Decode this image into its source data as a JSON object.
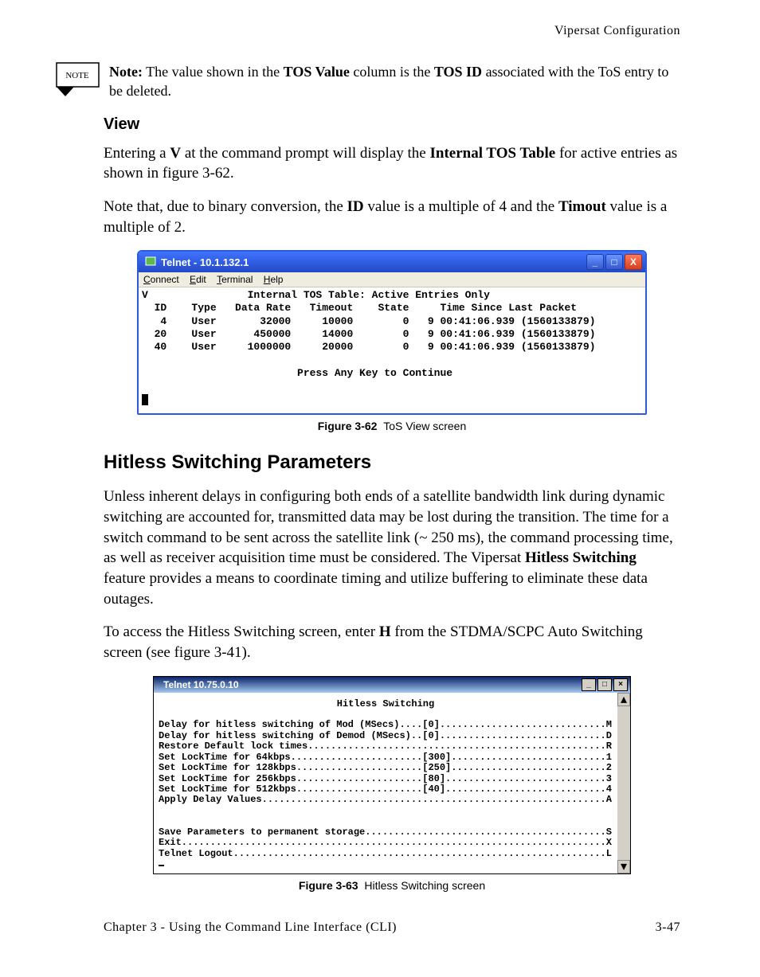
{
  "runningHead": "Vipersat Configuration",
  "note": {
    "label": "Note:",
    "text_before": "The value shown in the ",
    "tos_value": "TOS Value",
    "text_mid": " column is the ",
    "tos_id": "TOS ID",
    "text_after": " associated with the ToS entry to be deleted.",
    "iconLabel": "NOTE"
  },
  "view": {
    "heading": "View",
    "p1_a": "Entering a ",
    "p1_V": "V",
    "p1_b": " at the command prompt will display the ",
    "p1_ITT": "Internal TOS Table",
    "p1_c": " for active entries as shown in figure 3-62.",
    "p2_a": "Note that, due to binary conversion, the ",
    "p2_ID": "ID",
    "p2_b": " value is a multiple of 4 and the ",
    "p2_T": "Timout",
    "p2_c": " value is a multiple of 2."
  },
  "win1": {
    "title": "Telnet - 10.1.132.1",
    "menu": {
      "connect": "Connect",
      "edit": "Edit",
      "terminal": "Terminal",
      "help": "Help"
    },
    "terminalLines": [
      "V                Internal TOS Table: Active Entries Only",
      "  ID    Type   Data Rate   Timeout    State     Time Since Last Packet",
      "   4    User       32000     10000        0   9 00:41:06.939 (1560133879)",
      "  20    User      450000     14000        0   9 00:41:06.939 (1560133879)",
      "  40    User     1000000     20000        0   9 00:41:06.939 (1560133879)",
      "",
      "                         Press Any Key to Continue",
      ""
    ],
    "caption_b": "Figure 3-62",
    "caption_r": "ToS View screen"
  },
  "hitless": {
    "heading": "Hitless Switching Parameters",
    "p1_a": "Unless inherent delays in configuring both ends of a satellite bandwidth link during dynamic switching are accounted for, transmitted data may be lost during the transition. The time for a switch command to be sent across the satellite link (~ 250 ms), the command processing time, as well as receiver acquisition time must be considered. The Vipersat ",
    "p1_HS": "Hitless Switching",
    "p1_b": " feature provides a means to coordinate timing and utilize buffering to eliminate these data outages.",
    "p2_a": "To access the Hitless Switching screen, enter ",
    "p2_H": "H",
    "p2_b": " from the STDMA/SCPC Auto Switching screen (see figure 3-41)."
  },
  "win2": {
    "title": "Telnet 10.75.0.10",
    "heading": "Hitless Switching",
    "lines": [
      "Delay for hitless switching of Mod (MSecs)....[0].............................M",
      "Delay for hitless switching of Demod (MSecs)..[0].............................D",
      "Restore Default lock times....................................................R",
      "Set LockTime for 64kbps.......................[300]...........................1",
      "Set LockTime for 128kbps......................[250]...........................2",
      "Set LockTime for 256kbps......................[80]............................3",
      "Set LockTime for 512kbps......................[40]............................4",
      "Apply Delay Values............................................................A",
      "",
      "",
      "Save Parameters to permanent storage..........................................S",
      "Exit..........................................................................X",
      "Telnet Logout.................................................................L"
    ],
    "caption_b": "Figure 3-63",
    "caption_r": "Hitless Switching screen"
  },
  "footer": {
    "left": "Chapter 3 - Using the Command Line Interface (CLI)",
    "right": "3-47"
  },
  "icons": {
    "minimize": "_",
    "maximize": "□",
    "close": "X",
    "minimize2": "_",
    "maximize2": "□",
    "close2": "×",
    "up": "▴",
    "down": "▾"
  }
}
